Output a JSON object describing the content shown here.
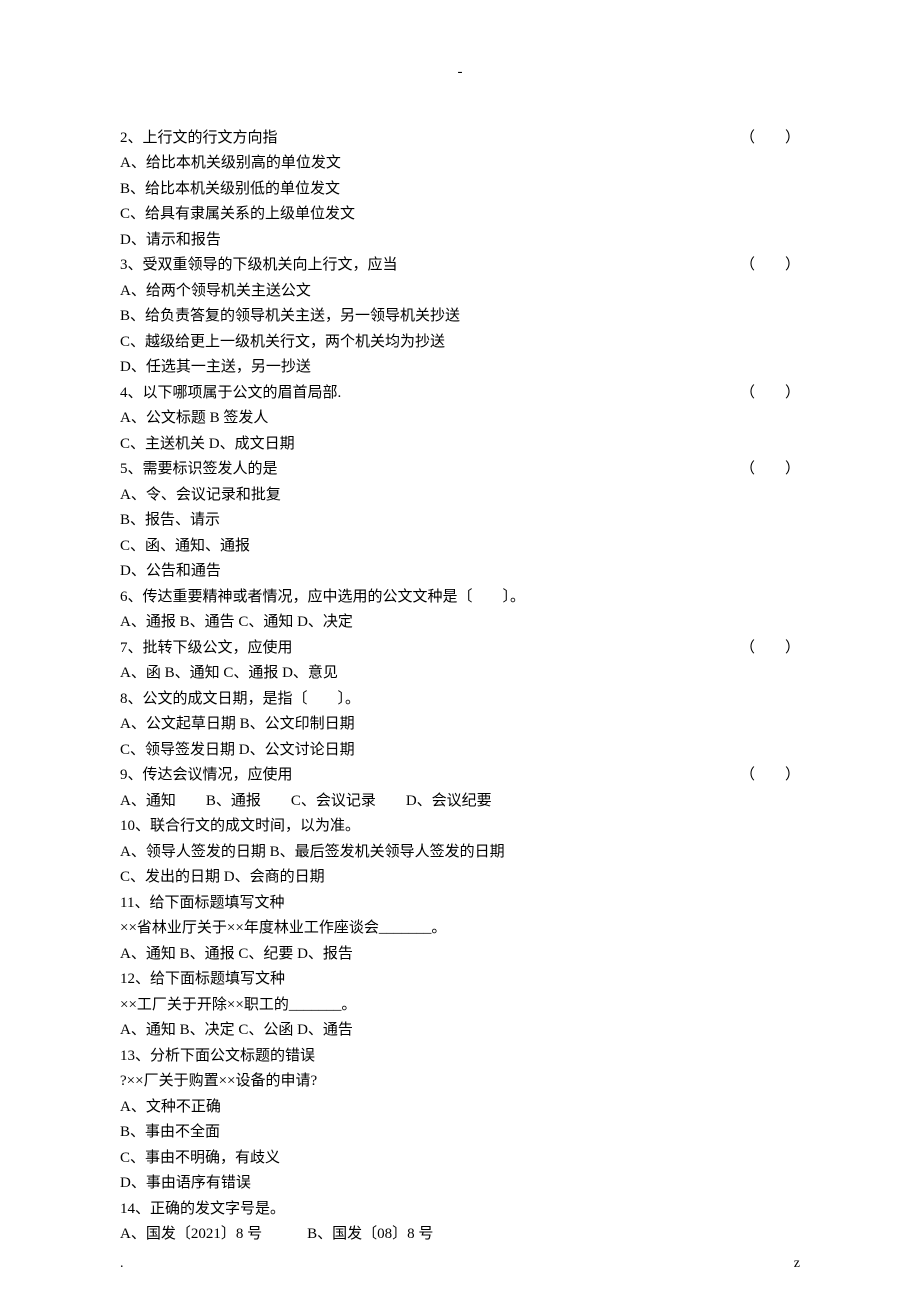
{
  "top_dash": "-",
  "paren_open": "（",
  "paren_gap": "　　",
  "paren_close": "）",
  "questions": [
    {
      "num": " 2、",
      "text": "上行文的行文方向指",
      "paren": true,
      "opts": [
        "A、给比本机关级别高的单位发文",
        "B、给比本机关级别低的单位发文",
        "C、给具有隶属关系的上级单位发文",
        "D、请示和报告"
      ]
    },
    {
      "num": "3、",
      "text": "受双重领导的下级机关向上行文，应当",
      "paren": true,
      "opts": [
        "A、给两个领导机关主送公文",
        "B、给负责答复的领导机关主送，另一领导机关抄送",
        "C、越级给更上一级机关行文，两个机关均为抄送",
        "D、任选其一主送，另一抄送"
      ]
    },
    {
      "num": "4、",
      "text": "以下哪项属于公文的眉首局部.",
      "paren": true,
      "opts": [
        "A、公文标题 B 签发人",
        "C、主送机关 D、成文日期"
      ]
    },
    {
      "num": "5、",
      "text": "需要标识签发人的是",
      "paren": true,
      "opts": [
        "A、令、会议记录和批复",
        "B、报告、请示",
        "C、函、通知、通报",
        "D、公告和通告"
      ]
    },
    {
      "num": "6、",
      "text": "传达重要精神或者情况，应中选用的公文文种是〔　　〕。",
      "paren": false,
      "opts": [
        "A、通报 B、通告 C、通知 D、决定"
      ]
    },
    {
      "num": "7、",
      "text": "批转下级公文，应使用",
      "paren": true,
      "opts": [
        "A、函 B、通知 C、通报 D、意见"
      ]
    },
    {
      "num": "8、",
      "text": "公文的成文日期，是指〔　　〕。",
      "paren": false,
      "opts": [
        "A、公文起草日期 B、公文印制日期",
        "C、领导签发日期 D、公文讨论日期"
      ]
    },
    {
      "num": "9、",
      "text": "传达会议情况，应使用",
      "paren": true,
      "opts": [
        "A、通知　　B、通报　　C、会议记录　　D、会议纪要"
      ]
    },
    {
      "num": "10、",
      "text": "联合行文的成文时间，以为准。",
      "paren": false,
      "opts": [
        "A、领导人签发的日期 B、最后签发机关领导人签发的日期",
        "C、发出的日期 D、会商的日期"
      ]
    },
    {
      "num": "11、",
      "text": "给下面标题填写文种",
      "paren": false,
      "opts": [
        "××省林业厅关于××年度林业工作座谈会_______。",
        "A、通知 B、通报 C、纪要 D、报告"
      ]
    },
    {
      "num": "12、",
      "text": "给下面标题填写文种",
      "paren": false,
      "opts": [
        "××工厂关于开除××职工的_______。",
        "A、通知 B、决定 C、公函 D、通告"
      ]
    },
    {
      "num": "13、",
      "text": "分析下面公文标题的错误",
      "paren": false,
      "opts": [
        "?××厂关于购置××设备的申请?",
        "A、文种不正确",
        "B、事由不全面",
        "C、事由不明确，有歧义",
        "D、事由语序有错误"
      ]
    },
    {
      "num": "14、",
      "text": "正确的发文字号是。",
      "paren": false,
      "opts": [
        "A、国发〔2021〕8 号　　　B、国发〔08〕8 号"
      ]
    }
  ],
  "footer_left": ".",
  "footer_right": "z"
}
